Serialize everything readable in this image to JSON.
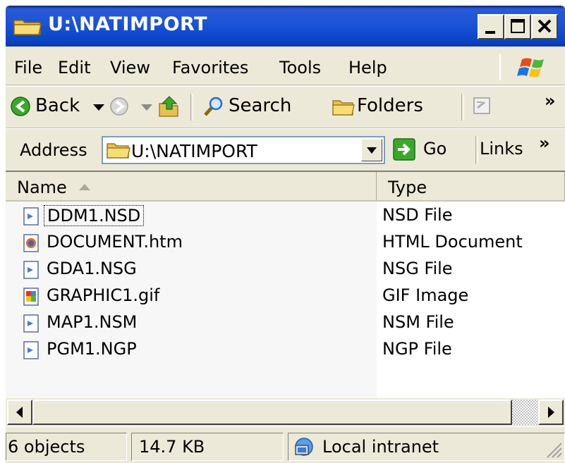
{
  "window": {
    "title": "U:\\NATIMPORT"
  },
  "menu": {
    "file": "File",
    "edit": "Edit",
    "view": "View",
    "favorites": "Favorites",
    "tools": "Tools",
    "help": "Help"
  },
  "toolbar": {
    "back": "Back",
    "search": "Search",
    "folders": "Folders",
    "more": "»"
  },
  "address": {
    "label": "Address",
    "value": "U:\\NATIMPORT",
    "go": "Go",
    "links": "Links",
    "links_more": "»"
  },
  "columns": {
    "name": "Name",
    "type": "Type"
  },
  "files": [
    {
      "name": "DDM1.NSD",
      "type": "NSD File",
      "icon": "nsd-file-icon"
    },
    {
      "name": "DOCUMENT.htm",
      "type": "HTML Document",
      "icon": "html-document-icon"
    },
    {
      "name": "GDA1.NSG",
      "type": "NSG File",
      "icon": "nsg-file-icon"
    },
    {
      "name": "GRAPHIC1.gif",
      "type": "GIF Image",
      "icon": "gif-image-icon"
    },
    {
      "name": "MAP1.NSM",
      "type": "NSM File",
      "icon": "nsm-file-icon"
    },
    {
      "name": "PGM1.NGP",
      "type": "NGP File",
      "icon": "ngp-file-icon"
    }
  ],
  "status": {
    "objects": "6 objects",
    "size": "14.7 KB",
    "zone": "Local intranet"
  },
  "colors": {
    "title_bar": "#0b47c9",
    "window_face": "#ece9d8",
    "address_border": "#7f9db9"
  }
}
